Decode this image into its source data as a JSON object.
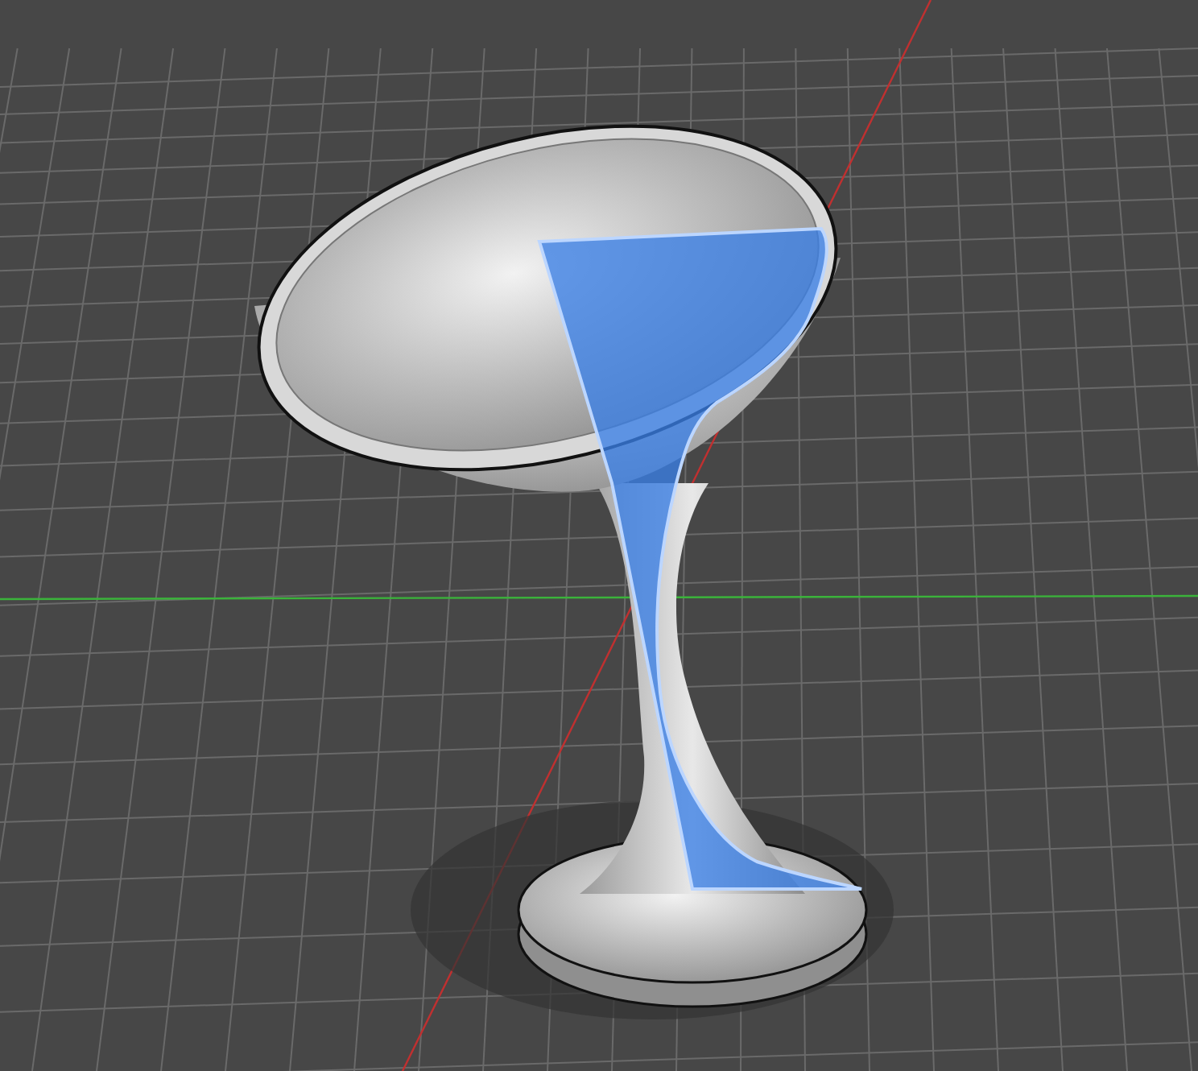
{
  "viewport": {
    "profile_selected": true
  }
}
